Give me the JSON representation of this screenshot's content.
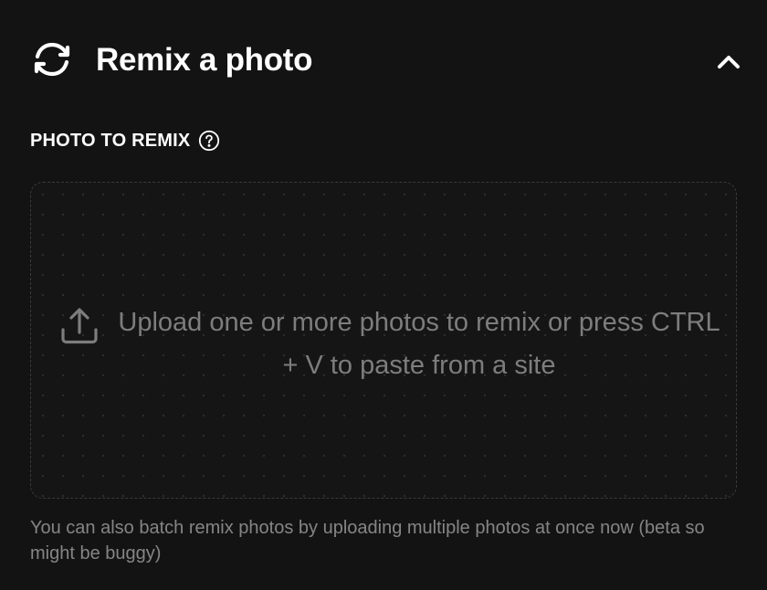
{
  "panel": {
    "title": "Remix a photo",
    "title_icon": "remix-refresh-icon",
    "collapse_icon": "chevron-up-icon"
  },
  "photo_section": {
    "label": "PHOTO TO REMIX",
    "help_icon": "question-circle-icon"
  },
  "dropzone": {
    "icon": "upload-icon",
    "text": "Upload one or more photos to remix or press CTRL + V to paste from a site"
  },
  "note": {
    "text": "You can also batch remix photos by uploading multiple photos at once now (beta so might be buggy)"
  },
  "colors": {
    "background": "#131313",
    "text_primary": "#ffffff",
    "text_muted": "#7d7d7d",
    "border": "#3a3a3a"
  }
}
